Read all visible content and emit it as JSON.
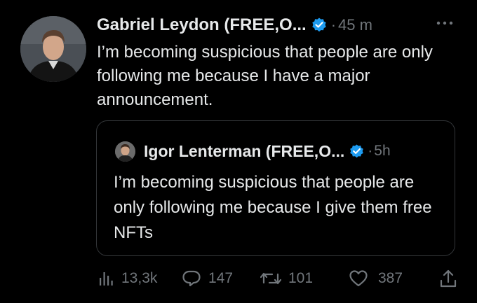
{
  "tweet": {
    "author_name": "Gabriel Leydon (FREE,O...",
    "separator": "·",
    "time": "45 m",
    "text": "I’m becoming suspicious that people are only following me because I have a major announcement.",
    "avatar_icon": "person-avatar",
    "verified_icon": "verified-badge-icon",
    "more_icon": "more-options-icon"
  },
  "quote": {
    "author_name": "Igor Lenterman (FREE,O...",
    "separator": "·",
    "time": "5h",
    "text": "I’m becoming suspicious that people are only following me because I give them free NFTs",
    "verified_icon": "verified-badge-icon"
  },
  "actions": {
    "views": "13,3k",
    "replies": "147",
    "retweets": "101",
    "likes": "387"
  },
  "colors": {
    "background": "#000000",
    "text_primary": "#e7e9ea",
    "text_secondary": "#71767b",
    "verified_blue": "#1d9bf0",
    "border": "#333639"
  }
}
